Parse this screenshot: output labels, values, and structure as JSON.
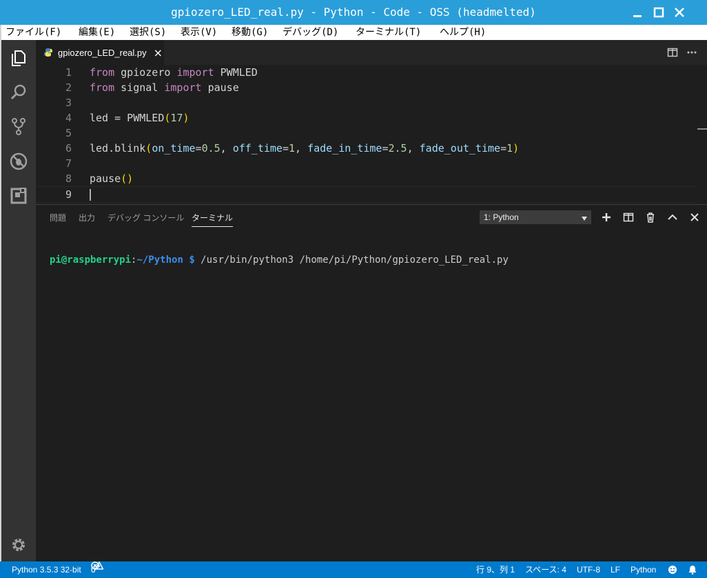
{
  "window": {
    "title": "gpiozero_LED_real.py - Python - Code - OSS (headmelted)"
  },
  "menu": [
    "ファイル(F)",
    "編集(E)",
    "選択(S)",
    "表示(V)",
    "移動(G)",
    "デバッグ(D)",
    "ターミナル(T)",
    "ヘルプ(H)"
  ],
  "tab": {
    "filename": "gpiozero_LED_real.py",
    "close": "×"
  },
  "code": {
    "line_numbers": [
      "1",
      "2",
      "3",
      "4",
      "5",
      "6",
      "7",
      "8",
      "9"
    ],
    "l1": {
      "kw1": "from",
      "mod": " gpiozero ",
      "kw2": "import",
      "name": " PWMLED"
    },
    "l2": {
      "kw1": "from",
      "mod": " signal ",
      "kw2": "import",
      "name": " pause"
    },
    "l4": {
      "a": "led = PWMLED",
      "p1": "(",
      "n": "17",
      "p2": ")"
    },
    "l6": {
      "a": "led.blink",
      "p1": "(",
      "k1": "on_time",
      "e1": "=",
      "v1": "0.5",
      "c1": ", ",
      "k2": "off_time",
      "e2": "=",
      "v2": "1",
      "c2": ", ",
      "k3": "fade_in_time",
      "e3": "=",
      "v3": "2.5",
      "c3": ", ",
      "k4": "fade_out_time",
      "e4": "=",
      "v4": "1",
      "p2": ")"
    },
    "l8": {
      "a": "pause",
      "p": "()"
    }
  },
  "panel": {
    "tabs": [
      "問題",
      "出力",
      "デバッグ コンソール",
      "ターミナル"
    ],
    "active_tab": "ターミナル",
    "terminal_select": "1: Python",
    "prompt_user": "pi@raspberrypi",
    "prompt_sep": ":",
    "prompt_path": "~/Python",
    "prompt_dollar": " $",
    "command": " /usr/bin/python3 /home/pi/Python/gpiozero_LED_real.py"
  },
  "status": {
    "interpreter": "Python 3.5.3 32-bit",
    "errors": "0",
    "warnings": "0",
    "position": "行 9、列 1",
    "spaces": "スペース: 4",
    "encoding": "UTF-8",
    "eol": "LF",
    "language": "Python"
  },
  "colors": {
    "titlebar": "#2a9ed9",
    "statusbar": "#007acc",
    "keyword": "#c586c0",
    "number": "#b5cea8",
    "parameter": "#9cdcfe",
    "bracket": "#ffd700",
    "prompt_user": "#23d18b",
    "prompt_path": "#3b8eea"
  }
}
